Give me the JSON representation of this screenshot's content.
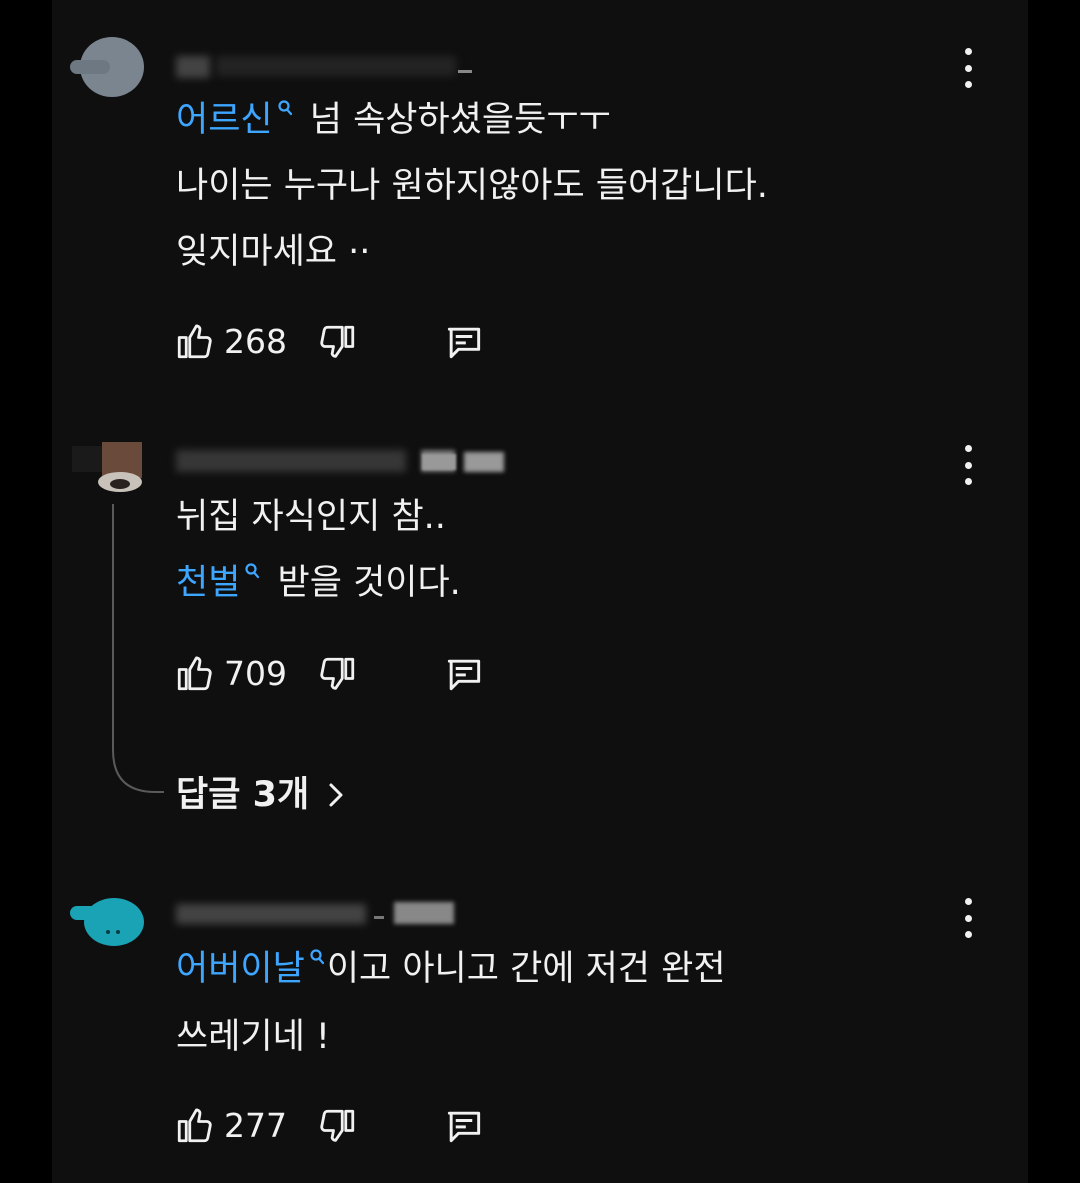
{
  "comments": [
    {
      "handle": "@··········",
      "tag": "어르신",
      "lines": [
        "넘 속상하셨을듯ㅜㅜ",
        "나이는 누구나 원하지않아도 들어갑니다.",
        "잊지마세요 ··"
      ],
      "likes": "268"
    },
    {
      "handle": "@··········",
      "lines": [
        "뉘집 자식인지 참..",
        "받을 것이다."
      ],
      "tag": "천벌",
      "likes": "709",
      "replies_label": "답글 3개"
    },
    {
      "handle": "@··········",
      "tag": "어버이날",
      "lines": [
        "이고 아니고 간에 저건 완전",
        "쓰레기네 !"
      ],
      "likes": "277"
    }
  ],
  "icons": {
    "like": "thumbs-up-icon",
    "dislike": "thumbs-down-icon",
    "reply": "reply-icon",
    "more": "more-vert-icon",
    "search_tag": "search-icon",
    "chevron": "chevron-right-icon"
  },
  "colors": {
    "background": "#0f0f0f",
    "text": "#f1f1f1",
    "tag": "#3ea6ff",
    "thread_line": "#5a5a5a"
  }
}
